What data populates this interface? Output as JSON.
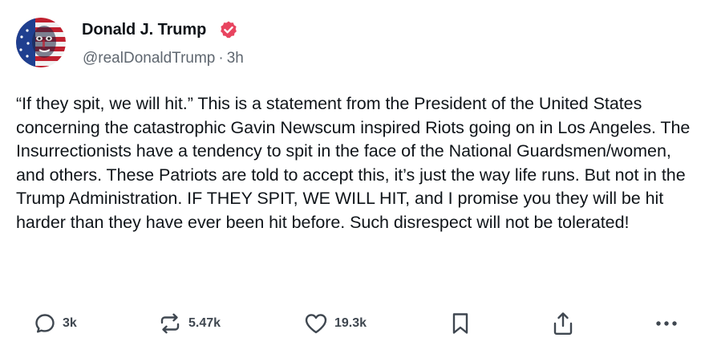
{
  "post": {
    "display_name": "Donald J. Trump",
    "handle": "@realDonaldTrump",
    "separator": "·",
    "time_ago": "3h",
    "text": "“If they spit, we will hit.” This is a statement from the President of the United States concerning the catastrophic Gavin Newscum inspired Riots going on in Los Angeles. The Insurrectionists have a tendency to spit in the face of the National Guardsmen/women, and others. These Patriots are told to accept this, it’s just the way life runs. But not in the Trump Administration. IF THEY SPIT, WE WILL HIT, and I promise you they will be hit harder than they have ever been hit before. Such disrespect will not be tolerated!"
  },
  "actions": {
    "reply_count": "3k",
    "repost_count": "5.47k",
    "like_count": "19.3k"
  },
  "icons": {
    "avatar": "avatar-flag-face",
    "verified": "verified-badge-icon",
    "reply": "comment-icon",
    "repost": "repost-icon",
    "like": "heart-icon",
    "bookmark": "bookmark-icon",
    "share": "share-icon",
    "more": "more-dots-icon"
  },
  "colors": {
    "verified_badge": "#e8445f",
    "text_primary": "#0f1419",
    "text_secondary": "#5f6770",
    "icon_gray": "#3f4750"
  }
}
